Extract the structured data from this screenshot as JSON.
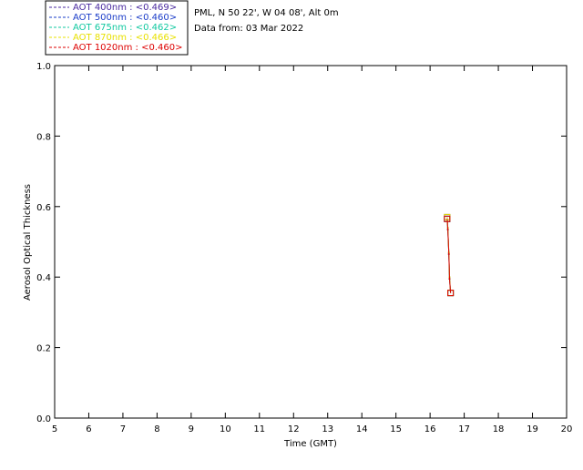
{
  "chart_data": {
    "type": "line",
    "title": "",
    "info_lines": [
      "PML, N 50 22', W 04 08', Alt 0m",
      "Data from: 03 Mar 2022"
    ],
    "xlabel": "Time (GMT)",
    "ylabel": "Aerosol Optical Thickness",
    "xlim": [
      5,
      20
    ],
    "ylim": [
      0.0,
      1.0
    ],
    "x_ticks": [
      5,
      6,
      7,
      8,
      9,
      10,
      11,
      12,
      13,
      14,
      15,
      16,
      17,
      18,
      19,
      20
    ],
    "x_tick_labels": [
      "5",
      "6",
      "7",
      "8",
      "9",
      "10",
      "11",
      "12",
      "13",
      "14",
      "15",
      "16",
      "17",
      "18",
      "19",
      "20"
    ],
    "y_ticks": [
      0.0,
      0.2,
      0.4,
      0.6,
      0.8,
      1.0
    ],
    "y_tick_labels": [
      "0.0",
      "0.2",
      "0.4",
      "0.6",
      "0.8",
      "1.0"
    ],
    "grid": false,
    "legend_position": "top-left, outside plot",
    "series": [
      {
        "name": "AOT  400nm",
        "mean_label": "<0.469>",
        "color": "#4a2aa0",
        "x": [
          16.5,
          16.52,
          16.55,
          16.57,
          16.6
        ],
        "y": [
          0.57,
          0.54,
          0.47,
          0.4,
          0.355
        ]
      },
      {
        "name": "AOT  500nm",
        "mean_label": "<0.460>",
        "color": "#1a3cc8",
        "x": [
          16.5,
          16.52,
          16.55,
          16.57,
          16.6
        ],
        "y": [
          0.565,
          0.535,
          0.465,
          0.395,
          0.355
        ]
      },
      {
        "name": "AOT  675nm",
        "mean_label": "<0.462>",
        "color": "#10c8a0",
        "x": [
          16.5,
          16.52,
          16.55,
          16.57,
          16.6
        ],
        "y": [
          0.565,
          0.535,
          0.465,
          0.395,
          0.355
        ]
      },
      {
        "name": "AOT  870nm",
        "mean_label": "<0.466>",
        "color": "#e8e000",
        "x": [
          16.5,
          16.52,
          16.55,
          16.57,
          16.6
        ],
        "y": [
          0.57,
          0.54,
          0.47,
          0.4,
          0.355
        ]
      },
      {
        "name": "AOT 1020nm",
        "mean_label": "<0.460>",
        "color": "#dd0000",
        "x": [
          16.5,
          16.52,
          16.55,
          16.57,
          16.6
        ],
        "y": [
          0.565,
          0.535,
          0.465,
          0.395,
          0.355
        ]
      }
    ]
  }
}
